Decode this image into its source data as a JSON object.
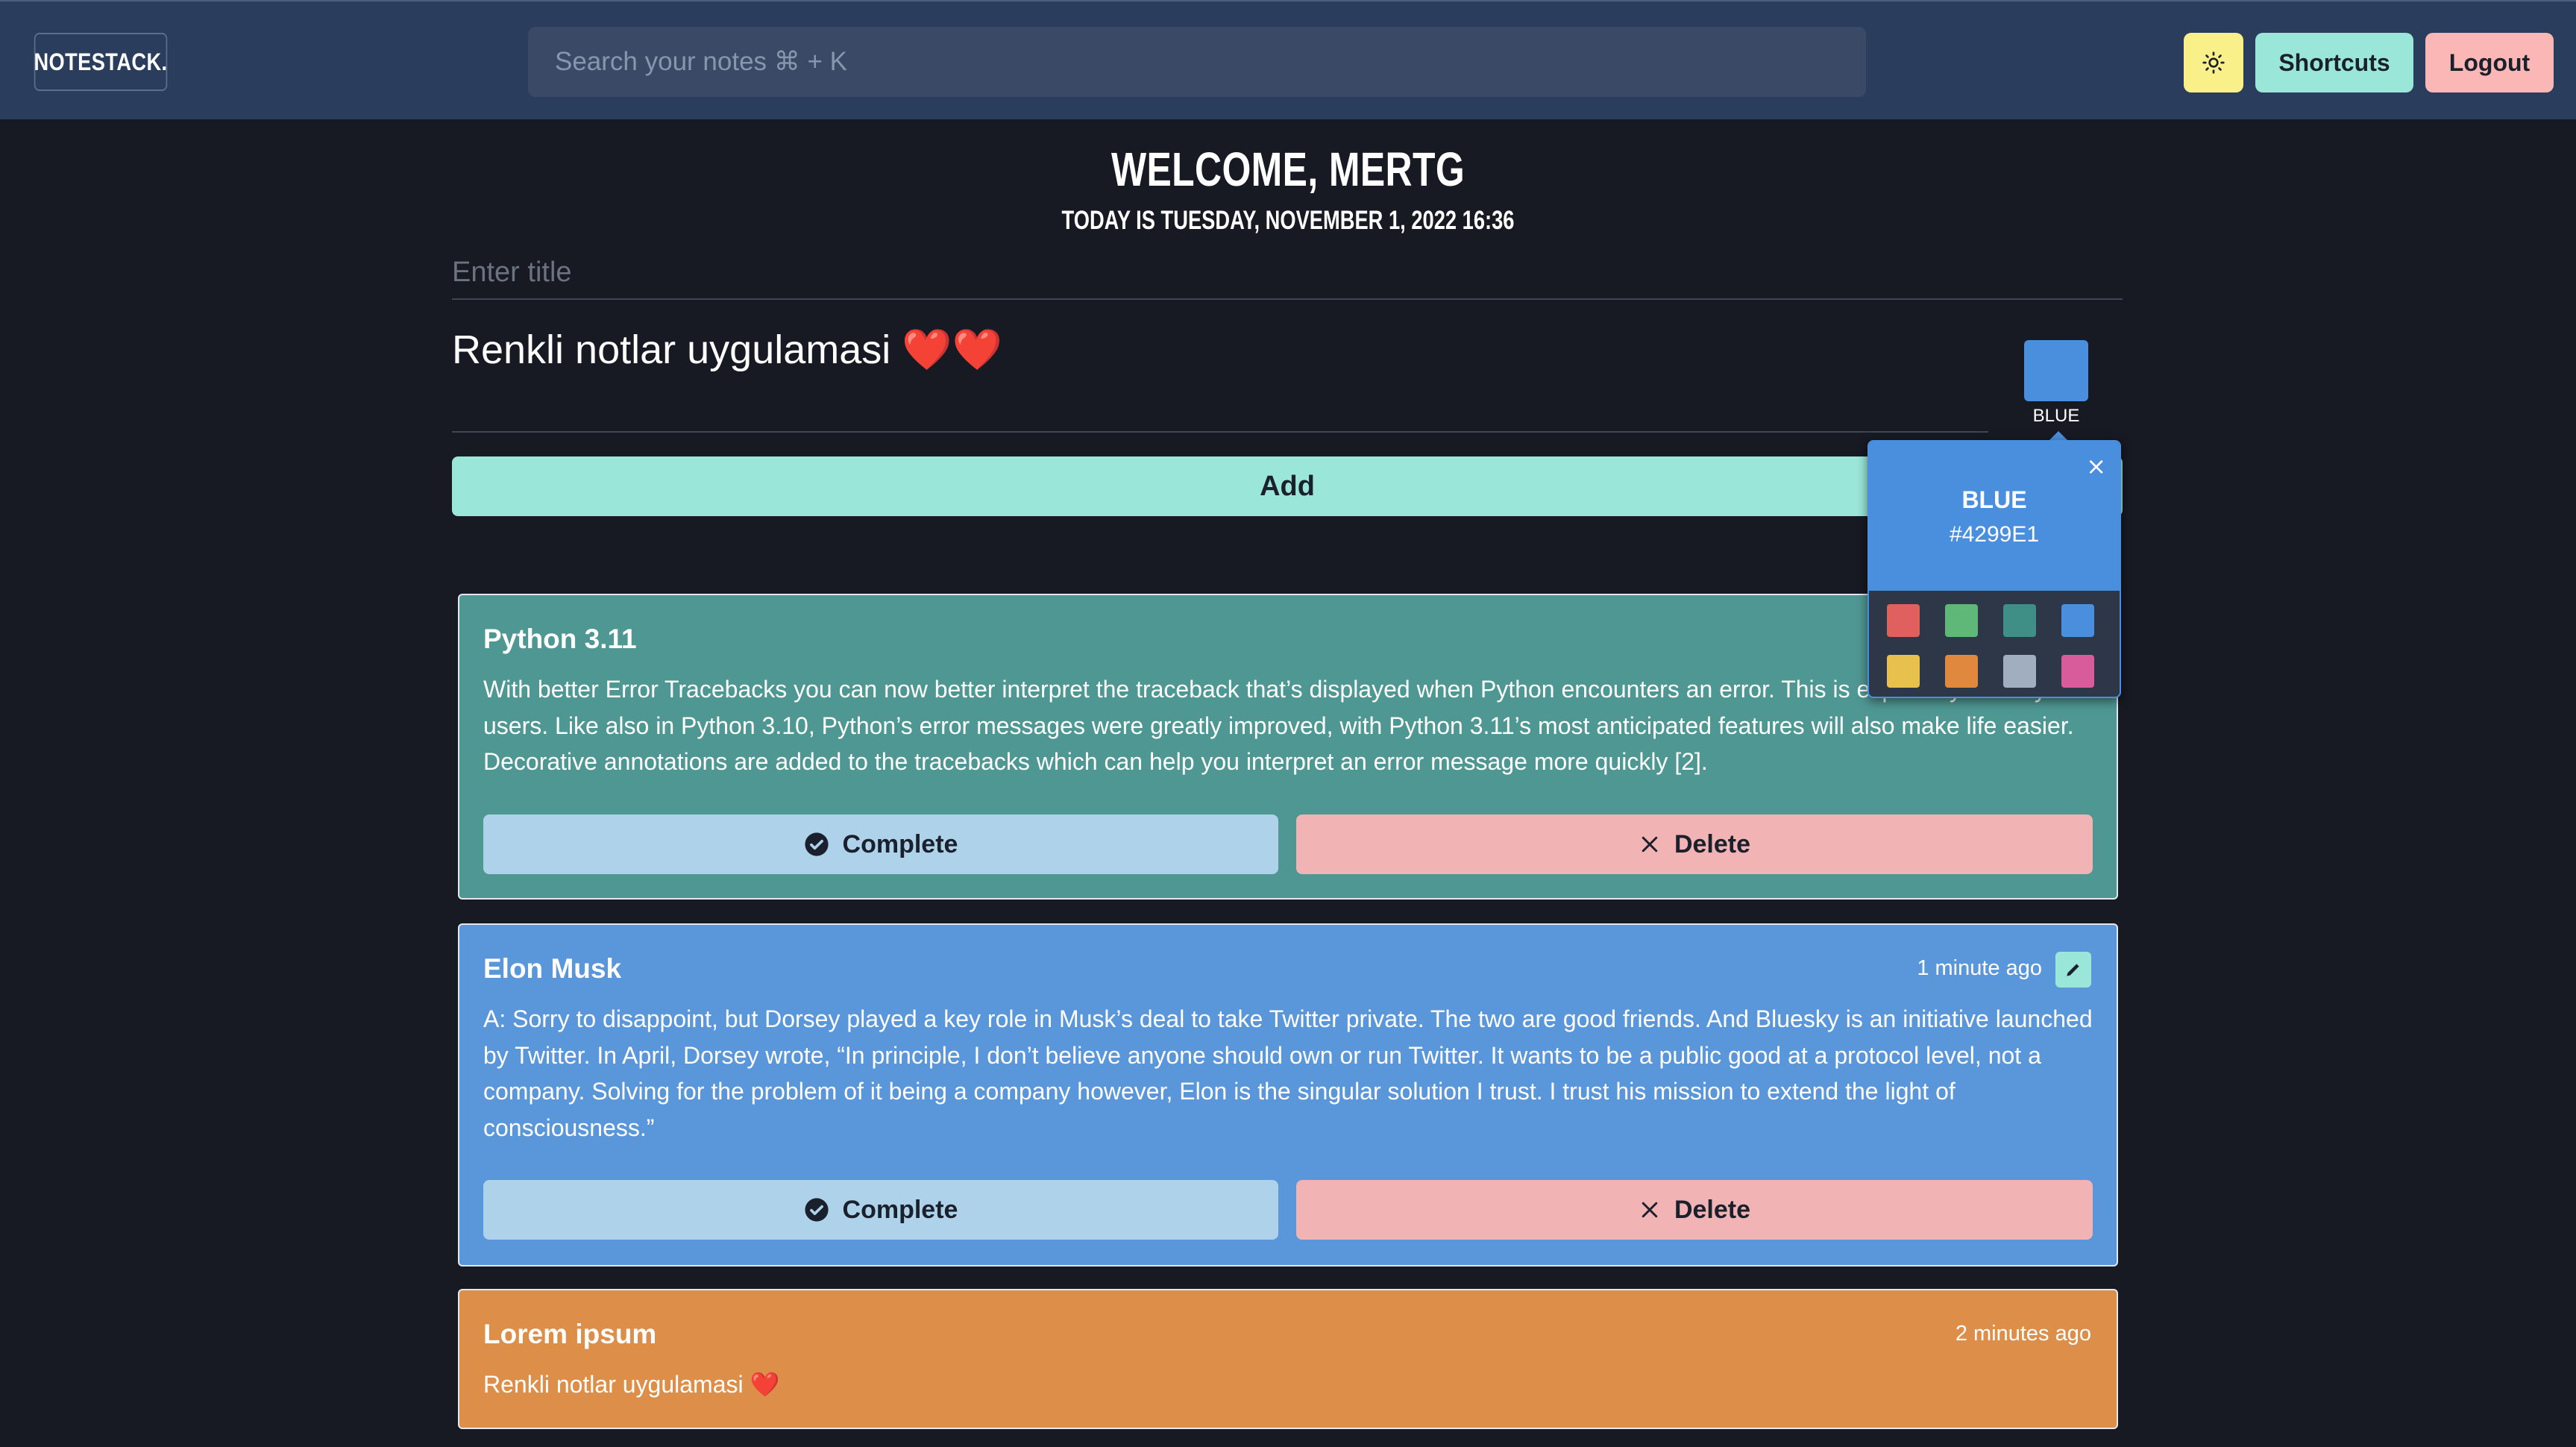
{
  "header": {
    "logo": "NOTESTACK.",
    "search_placeholder": "Search your notes ⌘ + K",
    "theme_icon": "sun-icon",
    "shortcuts_label": "Shortcuts",
    "logout_label": "Logout"
  },
  "main": {
    "welcome": "WELCOME, MERTG",
    "date": "TODAY IS TUESDAY, NOVEMBER 1, 2022 16:36",
    "title_placeholder": "Enter title",
    "body_value": "Renkli notlar uygulamasi ❤️❤️",
    "selected_color_label": "BLUE",
    "add_label": "Add"
  },
  "color_picker": {
    "name": "BLUE",
    "hex": "#4299E1",
    "close": "×",
    "colors": [
      "#e06060",
      "#5fb878",
      "#3f8f86",
      "#4a8fdd",
      "#e8c04e",
      "#e0883e",
      "#a0aec0",
      "#d85b9c"
    ]
  },
  "notes": [
    {
      "title": "Python 3.11",
      "time": "",
      "color": "#4f9793",
      "body": "With better Error Tracebacks you can now better interpret the traceback that’s displayed when Python encounters an error. This is especially new Python users. Like also in Python 3.10, Python’s error messages were greatly improved, with Python 3.11’s most anticipated features will also make life easier. Decorative annotations are added to the tracebacks which can help you interpret an error message more quickly [2].",
      "complete_label": "Complete",
      "delete_label": "Delete"
    },
    {
      "title": "Elon Musk",
      "time": "1 minute ago",
      "color": "#5a96da",
      "body": "A: Sorry to disappoint, but Dorsey played a key role in Musk’s deal to take Twitter private. The two are good friends. And Bluesky is an initiative launched by Twitter. In April, Dorsey wrote, “In principle, I don’t believe anyone should own or run Twitter. It wants to be a public good at a protocol level, not a company. Solving for the problem of it being a company however, Elon is the singular solution I trust. I trust his mission to extend the light of consciousness.”",
      "complete_label": "Complete",
      "delete_label": "Delete"
    },
    {
      "title": "Lorem ipsum",
      "time": "2 minutes ago",
      "color": "#dd8e49",
      "body": "Renkli notlar uygulamasi ❤️"
    }
  ]
}
